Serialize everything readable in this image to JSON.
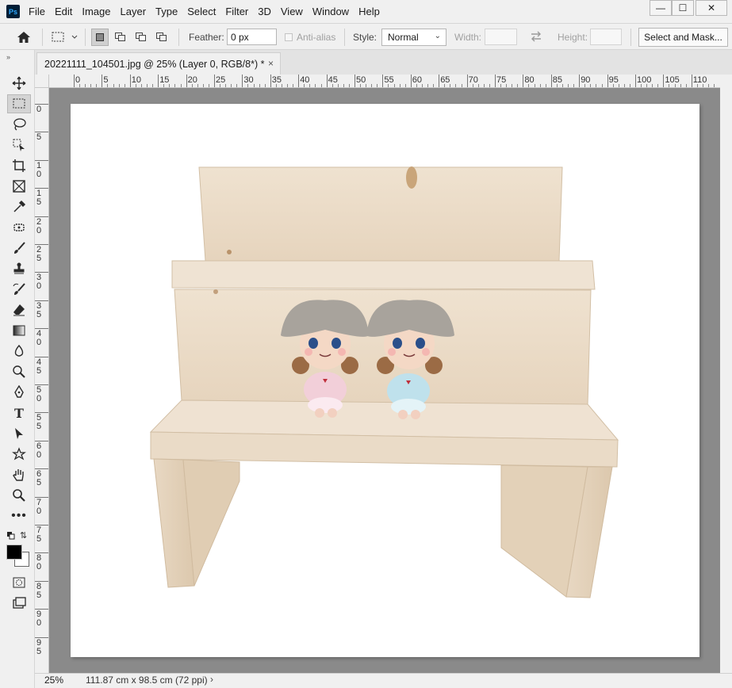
{
  "app": {
    "logo": "Ps"
  },
  "menu": [
    "File",
    "Edit",
    "Image",
    "Layer",
    "Type",
    "Select",
    "Filter",
    "3D",
    "View",
    "Window",
    "Help"
  ],
  "window_controls": {
    "minimize": "—",
    "maximize": "☐",
    "close": "✕"
  },
  "options": {
    "feather_label": "Feather:",
    "feather_value": "0 px",
    "antialias_label": "Anti-alias",
    "style_label": "Style:",
    "style_value": "Normal",
    "width_label": "Width:",
    "height_label": "Height:",
    "select_mask_label": "Select and Mask..."
  },
  "document_tab": {
    "title": "20221111_104501.jpg @ 25% (Layer 0, RGB/8*) *",
    "close": "×"
  },
  "ruler": {
    "top_labels": [
      "0",
      "5",
      "10",
      "15",
      "20",
      "25",
      "30",
      "35",
      "40",
      "45",
      "50",
      "55",
      "60",
      "65",
      "70",
      "75",
      "80",
      "85",
      "90",
      "95",
      "100",
      "105",
      "110"
    ],
    "left_labels": [
      "0",
      "5",
      "10",
      "15",
      "20",
      "25",
      "30",
      "35",
      "40",
      "45",
      "50",
      "55",
      "60",
      "65",
      "70",
      "75",
      "80",
      "85",
      "90",
      "95"
    ]
  },
  "status": {
    "zoom": "25%",
    "doc_info": "111.87 cm x 98.5 cm (72 ppi)",
    "arrow": "›"
  },
  "colors": {
    "foreground": "#000000",
    "background": "#ffffff",
    "workspace": "#8a8a8a",
    "wood": "#ecdcc8"
  },
  "tools": [
    "move-tool-icon",
    "marquee-tool-icon",
    "lasso-tool-icon",
    "object-select-tool-icon",
    "crop-tool-icon",
    "frame-tool-icon",
    "eyedropper-tool-icon",
    "spot-heal-tool-icon",
    "brush-tool-icon",
    "stamp-tool-icon",
    "history-brush-icon",
    "eraser-tool-icon",
    "gradient-tool-icon",
    "blur-tool-icon",
    "dodge-tool-icon",
    "pen-tool-icon",
    "type-tool-icon",
    "path-select-tool-icon",
    "shape-tool-icon",
    "hand-tool-icon",
    "zoom-tool-icon",
    "more-tools-icon"
  ]
}
